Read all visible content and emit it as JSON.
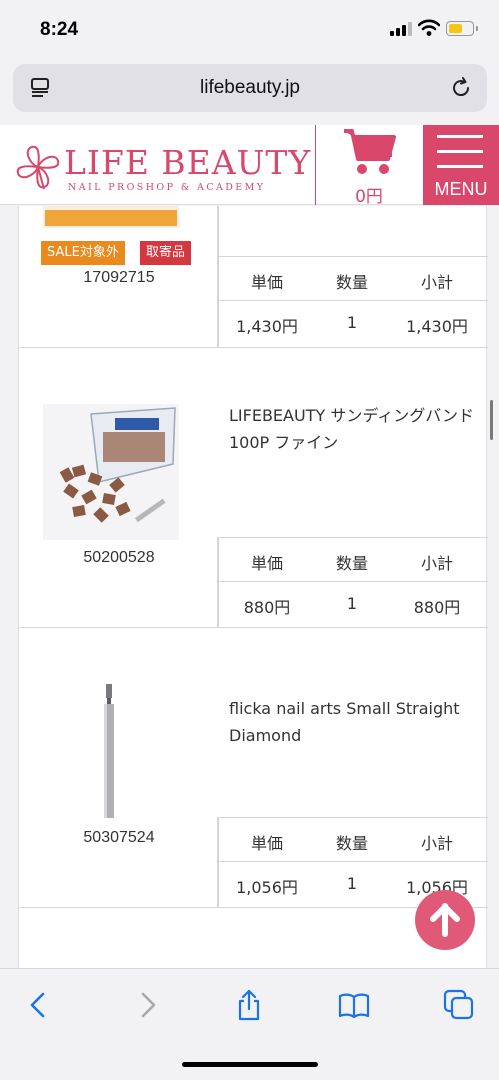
{
  "status_bar": {
    "time": "8:24",
    "icons": [
      "cellular-signal-icon",
      "wifi-icon",
      "battery-icon"
    ]
  },
  "browser": {
    "url": "lifebeauty.jp",
    "icons": [
      "reader-icon",
      "reload-icon"
    ]
  },
  "header": {
    "logo_main": "LIFE BEAUTY",
    "logo_sub": "NAIL PROSHOP & ACADEMY",
    "cart_amount": "0円",
    "menu_label": "MENU",
    "brand_color": "#d9476b"
  },
  "table_headers": {
    "unit_price": "単価",
    "quantity": "数量",
    "subtotal": "小計"
  },
  "items": [
    {
      "code": "17092715",
      "name": "",
      "tags": [
        "SALE対象外",
        "取寄品"
      ],
      "unit_price": "1,430円",
      "quantity": "1",
      "subtotal": "1,430円"
    },
    {
      "code": "50200528",
      "name": "LIFEBEAUTY サンディングバンド 100P ファイン",
      "unit_price": "880円",
      "quantity": "1",
      "subtotal": "880円"
    },
    {
      "code": "50307524",
      "name": "flicka nail arts Small Straight Diamond",
      "unit_price": "1,056円",
      "quantity": "1",
      "subtotal": "1,056円"
    }
  ],
  "floating": {
    "scroll_top_icon": "arrow-up-icon",
    "color": "#e05a78"
  },
  "toolbar": {
    "icons": [
      "back-icon",
      "forward-icon",
      "share-icon",
      "bookmarks-icon",
      "tabs-icon"
    ],
    "accent": "#1a73e8"
  }
}
